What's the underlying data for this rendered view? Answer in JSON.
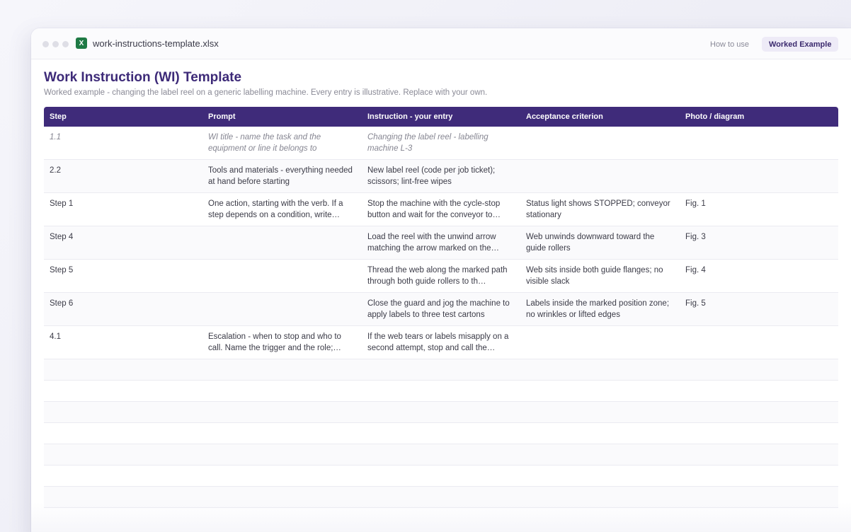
{
  "window": {
    "filename": "work-instructions-template.xlsx",
    "file_icon_letter": "X",
    "tabs": [
      {
        "label": "How to use",
        "active": false
      },
      {
        "label": "Worked Example",
        "active": true
      }
    ]
  },
  "document": {
    "title": "Work Instruction (WI) Template",
    "subtitle": "Worked example - changing the label reel on a generic labelling machine. Every entry is illustrative. Replace with your own."
  },
  "table": {
    "columns": [
      "Step",
      "Prompt",
      "Instruction - your entry",
      "Acceptance criterion",
      "Photo / diagram"
    ],
    "rows": [
      {
        "step": "1.1",
        "prompt": "WI title - name the task and the equipment or line it belongs to",
        "instruction": "Changing the label reel - labelling machine L-3",
        "criterion": "",
        "photo": "",
        "italic": true
      },
      {
        "step": "2.2",
        "prompt": "Tools and materials - everything needed at hand before starting",
        "instruction": "New label reel (code per job ticket); scissors; lint-free wipes",
        "criterion": "",
        "photo": "",
        "italic": false
      },
      {
        "step": "Step 1",
        "prompt": "One action, starting with the verb. If a step depends on a condition, write…",
        "instruction": "Stop the machine with the cycle-stop button and wait for the conveyor to…",
        "criterion": "Status light shows STOPPED; conveyor stationary",
        "photo": "Fig. 1",
        "italic": false
      },
      {
        "step": "Step 4",
        "prompt": "",
        "instruction": "Load the reel with the unwind arrow matching the arrow marked on the…",
        "criterion": "Web unwinds downward toward the guide rollers",
        "photo": "Fig. 3",
        "italic": false
      },
      {
        "step": "Step 5",
        "prompt": "",
        "instruction": "Thread the web along the marked path through both guide rollers to th…",
        "criterion": "Web sits inside both guide flanges; no visible slack",
        "photo": "Fig. 4",
        "italic": false
      },
      {
        "step": "Step 6",
        "prompt": "",
        "instruction": "Close the guard and jog the machine to apply labels to three test cartons",
        "criterion": "Labels inside the marked position zone; no wrinkles or lifted edges",
        "photo": "Fig. 5",
        "italic": false
      },
      {
        "step": "4.1",
        "prompt": "Escalation - when to stop and who to call. Name the trigger and the role;…",
        "instruction": "If the web tears or labels misapply on a second attempt, stop and call the…",
        "criterion": "",
        "photo": "",
        "italic": false
      }
    ],
    "empty_row_count": 7
  }
}
